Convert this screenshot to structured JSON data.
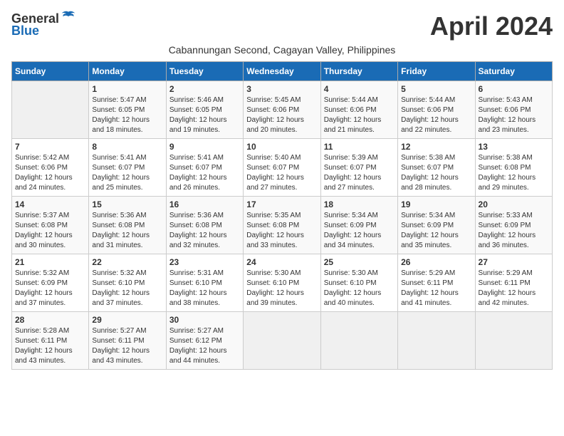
{
  "logo": {
    "general": "General",
    "blue": "Blue"
  },
  "title": "April 2024",
  "subtitle": "Cabannungan Second, Cagayan Valley, Philippines",
  "calendar": {
    "headers": [
      "Sunday",
      "Monday",
      "Tuesday",
      "Wednesday",
      "Thursday",
      "Friday",
      "Saturday"
    ],
    "weeks": [
      [
        {
          "day": "",
          "sunrise": "",
          "sunset": "",
          "daylight": ""
        },
        {
          "day": "1",
          "sunrise": "Sunrise: 5:47 AM",
          "sunset": "Sunset: 6:05 PM",
          "daylight": "Daylight: 12 hours and 18 minutes."
        },
        {
          "day": "2",
          "sunrise": "Sunrise: 5:46 AM",
          "sunset": "Sunset: 6:05 PM",
          "daylight": "Daylight: 12 hours and 19 minutes."
        },
        {
          "day": "3",
          "sunrise": "Sunrise: 5:45 AM",
          "sunset": "Sunset: 6:06 PM",
          "daylight": "Daylight: 12 hours and 20 minutes."
        },
        {
          "day": "4",
          "sunrise": "Sunrise: 5:44 AM",
          "sunset": "Sunset: 6:06 PM",
          "daylight": "Daylight: 12 hours and 21 minutes."
        },
        {
          "day": "5",
          "sunrise": "Sunrise: 5:44 AM",
          "sunset": "Sunset: 6:06 PM",
          "daylight": "Daylight: 12 hours and 22 minutes."
        },
        {
          "day": "6",
          "sunrise": "Sunrise: 5:43 AM",
          "sunset": "Sunset: 6:06 PM",
          "daylight": "Daylight: 12 hours and 23 minutes."
        }
      ],
      [
        {
          "day": "7",
          "sunrise": "Sunrise: 5:42 AM",
          "sunset": "Sunset: 6:06 PM",
          "daylight": "Daylight: 12 hours and 24 minutes."
        },
        {
          "day": "8",
          "sunrise": "Sunrise: 5:41 AM",
          "sunset": "Sunset: 6:07 PM",
          "daylight": "Daylight: 12 hours and 25 minutes."
        },
        {
          "day": "9",
          "sunrise": "Sunrise: 5:41 AM",
          "sunset": "Sunset: 6:07 PM",
          "daylight": "Daylight: 12 hours and 26 minutes."
        },
        {
          "day": "10",
          "sunrise": "Sunrise: 5:40 AM",
          "sunset": "Sunset: 6:07 PM",
          "daylight": "Daylight: 12 hours and 27 minutes."
        },
        {
          "day": "11",
          "sunrise": "Sunrise: 5:39 AM",
          "sunset": "Sunset: 6:07 PM",
          "daylight": "Daylight: 12 hours and 27 minutes."
        },
        {
          "day": "12",
          "sunrise": "Sunrise: 5:38 AM",
          "sunset": "Sunset: 6:07 PM",
          "daylight": "Daylight: 12 hours and 28 minutes."
        },
        {
          "day": "13",
          "sunrise": "Sunrise: 5:38 AM",
          "sunset": "Sunset: 6:08 PM",
          "daylight": "Daylight: 12 hours and 29 minutes."
        }
      ],
      [
        {
          "day": "14",
          "sunrise": "Sunrise: 5:37 AM",
          "sunset": "Sunset: 6:08 PM",
          "daylight": "Daylight: 12 hours and 30 minutes."
        },
        {
          "day": "15",
          "sunrise": "Sunrise: 5:36 AM",
          "sunset": "Sunset: 6:08 PM",
          "daylight": "Daylight: 12 hours and 31 minutes."
        },
        {
          "day": "16",
          "sunrise": "Sunrise: 5:36 AM",
          "sunset": "Sunset: 6:08 PM",
          "daylight": "Daylight: 12 hours and 32 minutes."
        },
        {
          "day": "17",
          "sunrise": "Sunrise: 5:35 AM",
          "sunset": "Sunset: 6:08 PM",
          "daylight": "Daylight: 12 hours and 33 minutes."
        },
        {
          "day": "18",
          "sunrise": "Sunrise: 5:34 AM",
          "sunset": "Sunset: 6:09 PM",
          "daylight": "Daylight: 12 hours and 34 minutes."
        },
        {
          "day": "19",
          "sunrise": "Sunrise: 5:34 AM",
          "sunset": "Sunset: 6:09 PM",
          "daylight": "Daylight: 12 hours and 35 minutes."
        },
        {
          "day": "20",
          "sunrise": "Sunrise: 5:33 AM",
          "sunset": "Sunset: 6:09 PM",
          "daylight": "Daylight: 12 hours and 36 minutes."
        }
      ],
      [
        {
          "day": "21",
          "sunrise": "Sunrise: 5:32 AM",
          "sunset": "Sunset: 6:09 PM",
          "daylight": "Daylight: 12 hours and 37 minutes."
        },
        {
          "day": "22",
          "sunrise": "Sunrise: 5:32 AM",
          "sunset": "Sunset: 6:10 PM",
          "daylight": "Daylight: 12 hours and 37 minutes."
        },
        {
          "day": "23",
          "sunrise": "Sunrise: 5:31 AM",
          "sunset": "Sunset: 6:10 PM",
          "daylight": "Daylight: 12 hours and 38 minutes."
        },
        {
          "day": "24",
          "sunrise": "Sunrise: 5:30 AM",
          "sunset": "Sunset: 6:10 PM",
          "daylight": "Daylight: 12 hours and 39 minutes."
        },
        {
          "day": "25",
          "sunrise": "Sunrise: 5:30 AM",
          "sunset": "Sunset: 6:10 PM",
          "daylight": "Daylight: 12 hours and 40 minutes."
        },
        {
          "day": "26",
          "sunrise": "Sunrise: 5:29 AM",
          "sunset": "Sunset: 6:11 PM",
          "daylight": "Daylight: 12 hours and 41 minutes."
        },
        {
          "day": "27",
          "sunrise": "Sunrise: 5:29 AM",
          "sunset": "Sunset: 6:11 PM",
          "daylight": "Daylight: 12 hours and 42 minutes."
        }
      ],
      [
        {
          "day": "28",
          "sunrise": "Sunrise: 5:28 AM",
          "sunset": "Sunset: 6:11 PM",
          "daylight": "Daylight: 12 hours and 43 minutes."
        },
        {
          "day": "29",
          "sunrise": "Sunrise: 5:27 AM",
          "sunset": "Sunset: 6:11 PM",
          "daylight": "Daylight: 12 hours and 43 minutes."
        },
        {
          "day": "30",
          "sunrise": "Sunrise: 5:27 AM",
          "sunset": "Sunset: 6:12 PM",
          "daylight": "Daylight: 12 hours and 44 minutes."
        },
        {
          "day": "",
          "sunrise": "",
          "sunset": "",
          "daylight": ""
        },
        {
          "day": "",
          "sunrise": "",
          "sunset": "",
          "daylight": ""
        },
        {
          "day": "",
          "sunrise": "",
          "sunset": "",
          "daylight": ""
        },
        {
          "day": "",
          "sunrise": "",
          "sunset": "",
          "daylight": ""
        }
      ]
    ]
  }
}
